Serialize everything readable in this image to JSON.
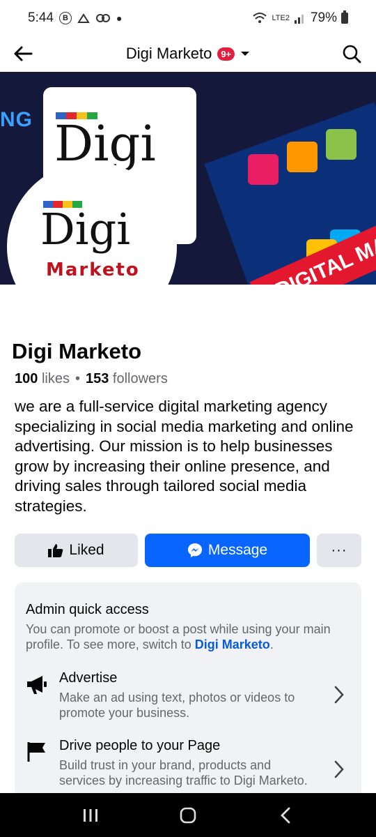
{
  "status": {
    "time": "5:44",
    "battery": "79%",
    "network_label": "LTE2"
  },
  "nav": {
    "title": "Digi Marketo",
    "badge": "9+"
  },
  "cover": {
    "left_text": "NG",
    "card_logo": "Digi",
    "banner_text": "DIGITAL MA"
  },
  "profile_pic": {
    "logo_text": "Digi",
    "sub_text": "Marketo"
  },
  "page": {
    "name": "Digi Marketo",
    "likes_count": "100",
    "likes_label": "likes",
    "separator": "•",
    "followers_count": "153",
    "followers_label": "followers",
    "bio": " we are a full-service digital marketing agency specializing in social media marketing and online advertising. Our mission is to help businesses grow by increasing their online presence, and driving sales through tailored social media strategies."
  },
  "actions": {
    "liked_label": "Liked",
    "message_label": "Message",
    "more_label": "···"
  },
  "admin": {
    "title": "Admin quick access",
    "desc_prefix": "You can promote or boost a post while using your main profile. To see more, switch to ",
    "desc_link": "Digi Marketo",
    "desc_suffix": ".",
    "rows": [
      {
        "title": "Advertise",
        "desc": "Make an ad using text, photos or videos to promote your business."
      },
      {
        "title": "Drive people to your Page",
        "desc": "Build trust in your brand, products and services by increasing traffic to Digi Marketo."
      }
    ]
  },
  "colors": {
    "primary_blue": "#0866ff",
    "link_blue": "#0a5bd6",
    "badge_red": "#e41e3f",
    "card_bg": "#f0f2f5"
  }
}
